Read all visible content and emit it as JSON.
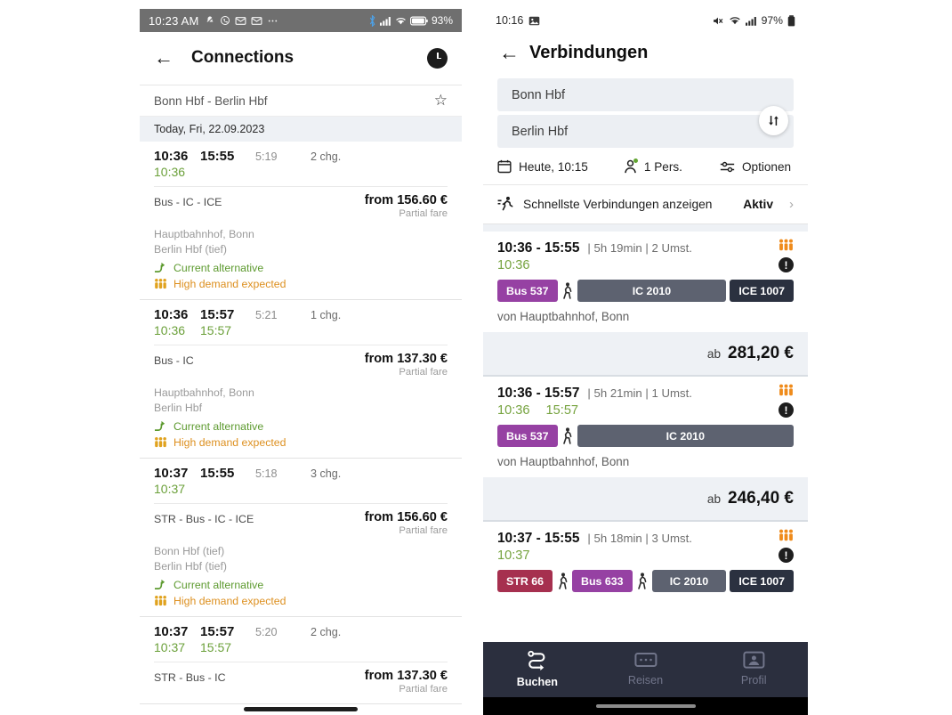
{
  "left": {
    "status_bar": {
      "time": "10:23 AM",
      "icons_left": [
        "mute-icon",
        "whatsapp-icon",
        "message-icon",
        "message-icon",
        "more-icon"
      ],
      "icons_right": [
        "bluetooth-icon",
        "signal-icon",
        "wifi-icon",
        "battery-icon"
      ],
      "battery": "93%"
    },
    "app_bar": {
      "back": "←",
      "title": "Connections",
      "clock_icon": "clock-icon"
    },
    "route": {
      "text": "Bonn Hbf - Berlin Hbf",
      "star": "☆"
    },
    "date_bar": "Today, Fri, 22.09.2023",
    "labels": {
      "current_alternative": "Current alternative",
      "high_demand": "High demand expected",
      "partial_fare": "Partial fare"
    },
    "connections": [
      {
        "dep": "10:36",
        "arr": "15:55",
        "duration": "5:19",
        "changes": "2 chg.",
        "rt_dep": "10:36",
        "rt_arr": "",
        "products": "Bus - IC - ICE",
        "price": "from 156.60 €",
        "partial": "Partial fare",
        "from_stop": "Hauptbahnhof, Bonn",
        "to_stop": "Berlin Hbf (tief)"
      },
      {
        "dep": "10:36",
        "arr": "15:57",
        "duration": "5:21",
        "changes": "1 chg.",
        "rt_dep": "10:36",
        "rt_arr": "15:57",
        "products": "Bus - IC",
        "price": "from 137.30 €",
        "partial": "Partial fare",
        "from_stop": "Hauptbahnhof, Bonn",
        "to_stop": "Berlin Hbf"
      },
      {
        "dep": "10:37",
        "arr": "15:55",
        "duration": "5:18",
        "changes": "3 chg.",
        "rt_dep": "10:37",
        "rt_arr": "",
        "products": "STR - Bus - IC - ICE",
        "price": "from 156.60 €",
        "partial": "Partial fare",
        "from_stop": "Bonn Hbf (tief)",
        "to_stop": "Berlin Hbf (tief)"
      },
      {
        "dep": "10:37",
        "arr": "15:57",
        "duration": "5:20",
        "changes": "2 chg.",
        "rt_dep": "10:37",
        "rt_arr": "15:57",
        "products": "STR - Bus - IC",
        "price": "from 137.30 €",
        "partial": "Partial fare",
        "from_stop": "",
        "to_stop": ""
      }
    ]
  },
  "right": {
    "status_bar": {
      "time": "10:16",
      "icons_left": [
        "screenshot-icon"
      ],
      "icons_right": [
        "mute-icon",
        "wifi-icon",
        "signal-icon",
        "battery-icon"
      ],
      "battery": "97%"
    },
    "app_bar": {
      "back": "←",
      "title": "Verbindungen"
    },
    "search": {
      "origin": "Bonn Hbf",
      "destination": "Berlin Hbf",
      "swap_icon": "swap-vertical-icon"
    },
    "options": {
      "date": "Heute, 10:15",
      "passengers": "1 Pers.",
      "options": "Optionen",
      "calendar_icon": "calendar-icon",
      "person_icon": "person-icon",
      "sliders_icon": "sliders-icon"
    },
    "fastest": {
      "icon": "running-person-icon",
      "label": "Schnellste Verbindungen anzeigen",
      "state": "Aktiv",
      "chevron": "›"
    },
    "connections": [
      {
        "range": "10:36 - 15:55",
        "meta": "| 5h 19min | 2 Umst.",
        "rt_dep": "10:36",
        "rt_arr": "",
        "legs": [
          {
            "type": "bus",
            "label": "Bus 537"
          },
          {
            "type": "walk",
            "label": "walk-icon"
          },
          {
            "type": "ic",
            "label": "IC 2010"
          },
          {
            "type": "ice",
            "label": "ICE 1007"
          }
        ],
        "from": "von Hauptbahnhof, Bonn",
        "price_prefix": "ab",
        "price": "281,20 €"
      },
      {
        "range": "10:36 - 15:57",
        "meta": "| 5h 21min | 1 Umst.",
        "rt_dep": "10:36",
        "rt_arr": "15:57",
        "legs": [
          {
            "type": "bus",
            "label": "Bus 537"
          },
          {
            "type": "walk",
            "label": "walk-icon"
          },
          {
            "type": "ic",
            "label": "IC 2010"
          }
        ],
        "from": "von Hauptbahnhof, Bonn",
        "price_prefix": "ab",
        "price": "246,40 €"
      },
      {
        "range": "10:37 - 15:55",
        "meta": "| 5h 18min | 3 Umst.",
        "rt_dep": "10:37",
        "rt_arr": "",
        "legs": [
          {
            "type": "str",
            "label": "STR 66"
          },
          {
            "type": "walk",
            "label": "walk-icon"
          },
          {
            "type": "bus",
            "label": "Bus 633"
          },
          {
            "type": "walk",
            "label": "walk-icon"
          },
          {
            "type": "ic",
            "label": "IC 2010"
          },
          {
            "type": "ice",
            "label": "ICE 1007"
          }
        ],
        "from": "",
        "price_prefix": "",
        "price": ""
      }
    ],
    "bottom_nav": [
      {
        "label": "Buchen",
        "icon": "route-icon",
        "active": true
      },
      {
        "label": "Reisen",
        "icon": "ticket-icon",
        "active": false
      },
      {
        "label": "Profil",
        "icon": "profile-icon",
        "active": false
      }
    ]
  },
  "colors": {
    "bus": "#9641a3",
    "str": "#a6304f",
    "ic": "#5d6270",
    "ice": "#2b3140",
    "realtime_green": "#76a33f",
    "demand_orange": "#e58a1f",
    "nav_bg": "#2b2f3e"
  }
}
